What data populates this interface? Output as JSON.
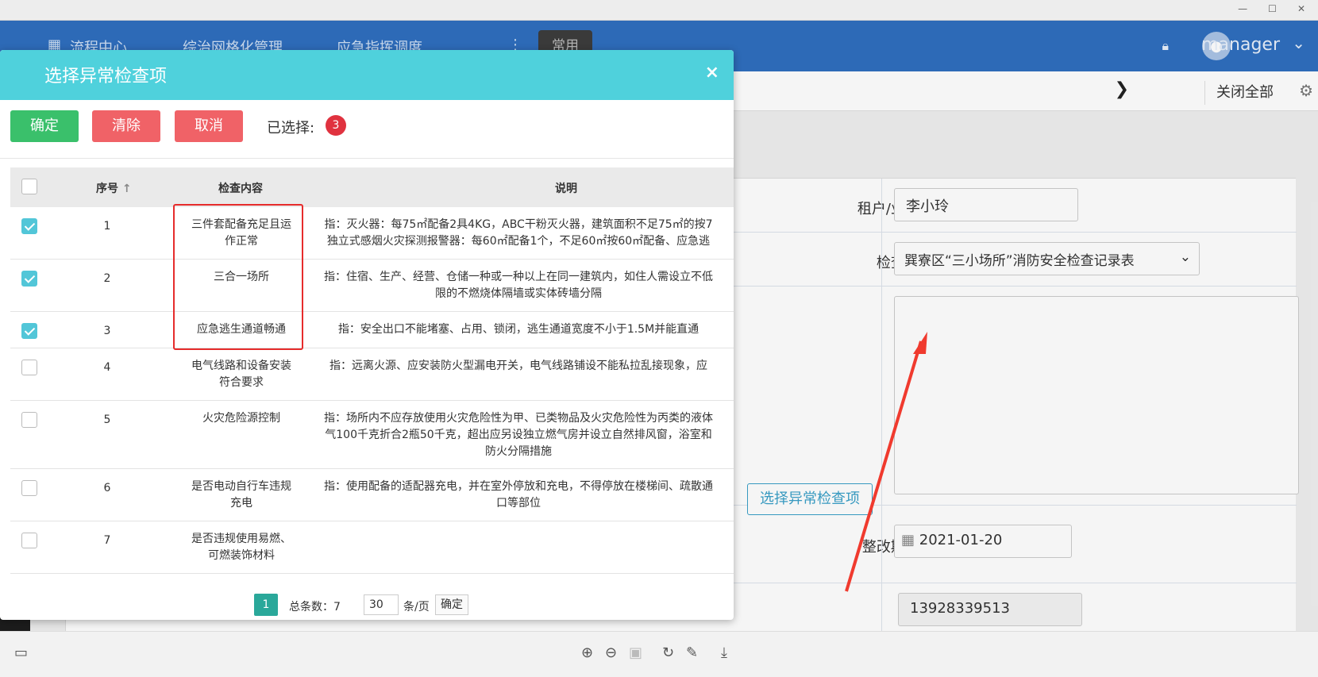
{
  "navbar": {
    "items": [
      "流程中心",
      "综治网格化管理",
      "应急指挥调度",
      "常用"
    ],
    "user": "manager"
  },
  "tabbar": {
    "close_all": "关闭全部"
  },
  "form": {
    "tenant_label": "租户/业主:",
    "tenant_value": "李小玲",
    "checklist_label": "检查表:",
    "checklist_value": "巽寮区“三小场所”消防安全检查记录表",
    "select_button": "选择异常检查项",
    "deadline_label": "整改期限:",
    "deadline_value": "2021-01-20",
    "phone_value": "13928339513"
  },
  "modal": {
    "title": "选择异常检查项",
    "close": "×",
    "toolbar": {
      "ok": "确定",
      "clear": "清除",
      "cancel": "取消",
      "selected_label": "已选择:",
      "selected_count": "3"
    },
    "table": {
      "headers": {
        "no": "序号",
        "item": "检查内容",
        "desc": "说明"
      },
      "rows": [
        {
          "no": "1",
          "checked": true,
          "item": [
            "三件套配备充足且运",
            "作正常"
          ],
          "desc": [
            "指：灭火器：每75㎡配备2具4KG，ABC干粉灭火器，建筑面积不足75㎡的按7",
            "独立式感烟火灾探测报警器：每60㎡配备1个，不足60㎡按60㎡配备、应急逃"
          ]
        },
        {
          "no": "2",
          "checked": true,
          "item": [
            "三合一场所"
          ],
          "desc": [
            "指：住宿、生产、经营、仓储一种或一种以上在同一建筑内，如住人需设立不低",
            "限的不燃烧体隔墙或实体砖墙分隔"
          ]
        },
        {
          "no": "3",
          "checked": true,
          "item": [
            "应急逃生通道畅通"
          ],
          "desc": [
            "指：安全出口不能堵塞、占用、锁闭，逃生通道宽度不小于1.5M并能直通"
          ]
        },
        {
          "no": "4",
          "checked": false,
          "item": [
            "电气线路和设备安装",
            "符合要求"
          ],
          "desc": [
            "指：远离火源、应安装防火型漏电开关，电气线路铺设不能私拉乱接现象，应"
          ]
        },
        {
          "no": "5",
          "checked": false,
          "item": [
            "火灾危险源控制"
          ],
          "desc": [
            "指：场所内不应存放使用火灾危险性为甲、已类物品及火灾危险性为丙类的液体",
            "气100千克折合2瓶50千克，超出应另设独立燃气房并设立自然排风窗，浴室和",
            "防火分隔措施"
          ]
        },
        {
          "no": "6",
          "checked": false,
          "item": [
            "是否电动自行车违规",
            "充电"
          ],
          "desc": [
            "指：使用配备的适配器充电，并在室外停放和充电，不得停放在楼梯间、疏散通",
            "口等部位"
          ]
        },
        {
          "no": "7",
          "checked": false,
          "item": [
            "是否违规使用易燃、",
            "可燃装饰材料"
          ],
          "desc": []
        }
      ]
    },
    "pager": {
      "current": "1",
      "total": "总条数：7",
      "size": "30",
      "unit": "条/页",
      "go": "确定"
    }
  }
}
